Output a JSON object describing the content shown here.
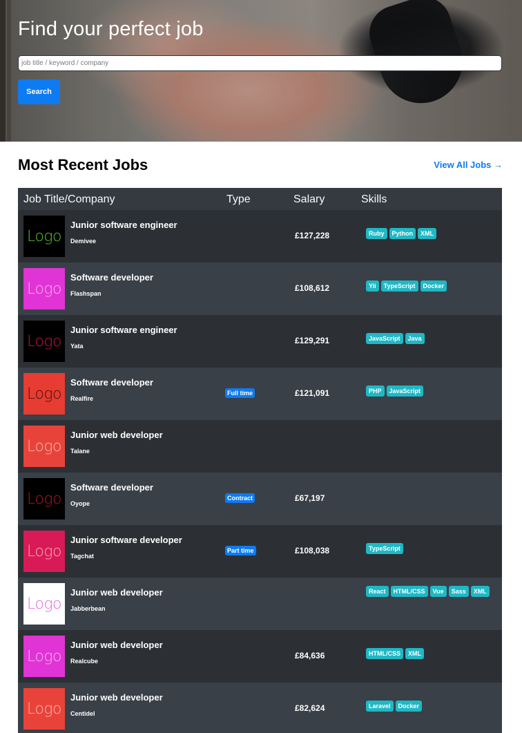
{
  "hero": {
    "title": "Find your perfect job",
    "search_placeholder": "job title / keyword / company",
    "search_button": "Search"
  },
  "section": {
    "title": "Most Recent Jobs",
    "view_all": "View All Jobs →"
  },
  "table": {
    "headers": [
      "Job Title/Company",
      "Type",
      "Salary",
      "Skills"
    ],
    "rows": [
      {
        "logo": "Logo",
        "logo_bg": "#000000",
        "logo_fg": "#5cbf2a",
        "title": "Junior software engineer",
        "company": "Demivee",
        "type": "",
        "salary": "£127,228",
        "skills": [
          "Ruby",
          "Python",
          "XML"
        ]
      },
      {
        "logo": "Logo",
        "logo_bg": "#e034d6",
        "logo_fg": "#f4b0e8",
        "title": "Software developer",
        "company": "Flashspan",
        "type": "",
        "salary": "£108,612",
        "skills": [
          "Yii",
          "TypeScript",
          "Docker"
        ]
      },
      {
        "logo": "Logo",
        "logo_bg": "#000000",
        "logo_fg": "#c2134a",
        "title": "Junior software engineer",
        "company": "Yata",
        "type": "",
        "salary": "£129,291",
        "skills": [
          "JavaScript",
          "Java"
        ]
      },
      {
        "logo": "Logo",
        "logo_bg": "#e63c32",
        "logo_fg": "#4a0e0a",
        "title": "Software developer",
        "company": "Realfire",
        "type": "Full time",
        "salary": "£121,091",
        "skills": [
          "PHP",
          "JavaScript"
        ]
      },
      {
        "logo": "Logo",
        "logo_bg": "#e8433a",
        "logo_fg": "#f9b2ad",
        "title": "Junior web developer",
        "company": "Talane",
        "type": "",
        "salary": "",
        "skills": []
      },
      {
        "logo": "Logo",
        "logo_bg": "#000000",
        "logo_fg": "#b51126",
        "title": "Software developer",
        "company": "Oyope",
        "type": "Contract",
        "salary": "£67,197",
        "skills": []
      },
      {
        "logo": "Logo",
        "logo_bg": "#d81b56",
        "logo_fg": "#f4a7bf",
        "title": "Junior software developer",
        "company": "Tagchat",
        "type": "Part time",
        "salary": "£108,038",
        "skills": [
          "TypeScript"
        ]
      },
      {
        "logo": "Logo",
        "logo_bg": "#ffffff",
        "logo_fg": "#e06be0",
        "title": "Junior web developer",
        "company": "Jabberbean",
        "type": "",
        "salary": "",
        "skills": [
          "React",
          "HTML/CSS",
          "Vue",
          "Sass",
          "XML"
        ]
      },
      {
        "logo": "Logo",
        "logo_bg": "#e034d6",
        "logo_fg": "#f4b0e8",
        "title": "Junior web developer",
        "company": "Realcube",
        "type": "",
        "salary": "£84,636",
        "skills": [
          "HTML/CSS",
          "XML"
        ]
      },
      {
        "logo": "Logo",
        "logo_bg": "#e8433a",
        "logo_fg": "#f9b2ad",
        "title": "Junior web developer",
        "company": "Centidel",
        "type": "",
        "salary": "£82,624",
        "skills": [
          "Laravel",
          "Docker"
        ]
      }
    ]
  },
  "colors": {
    "accent": "#0d7bf2",
    "skill_badge": "#1fb8c5",
    "table_dark": "#343a40"
  }
}
